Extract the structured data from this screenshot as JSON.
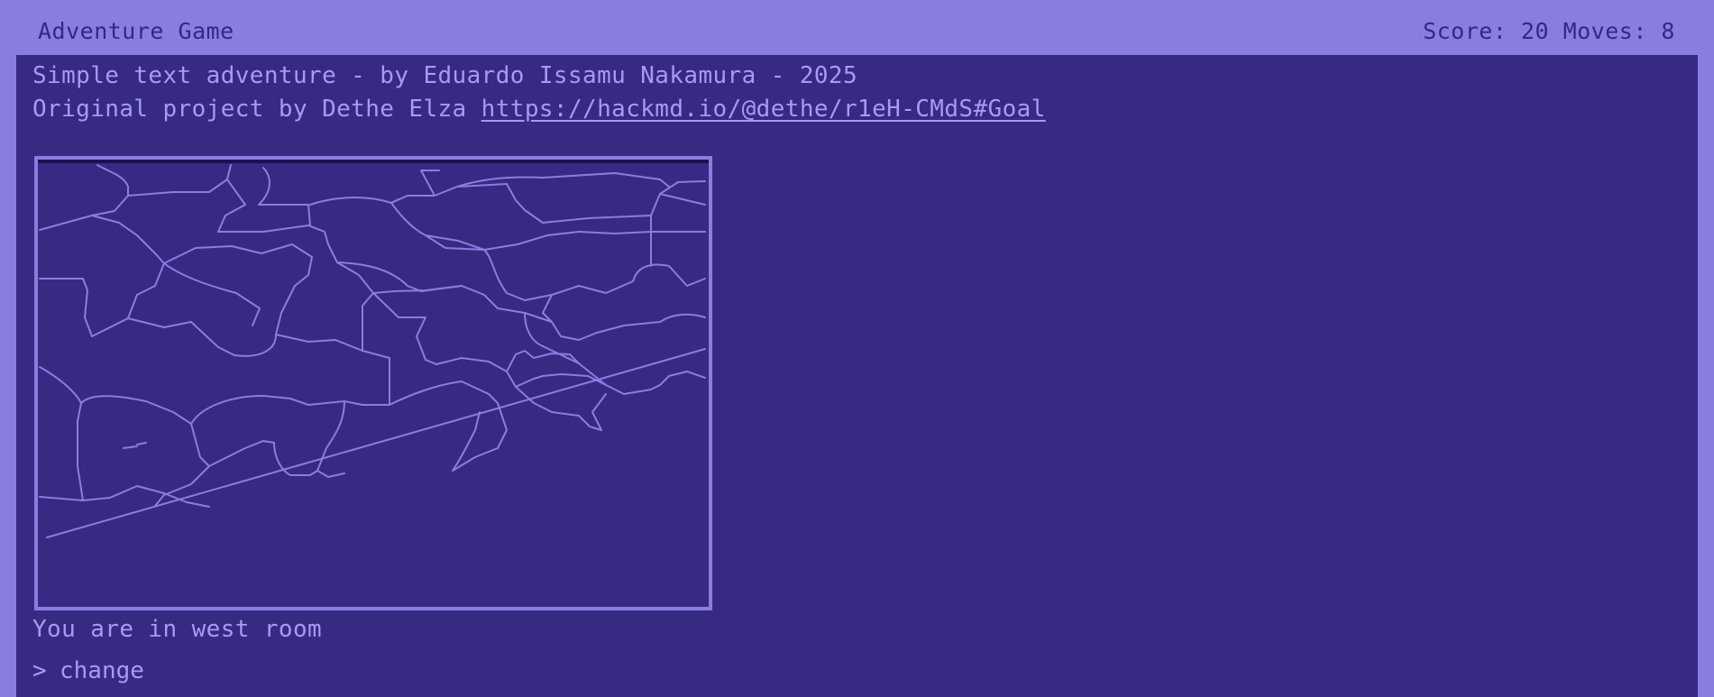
{
  "window": {
    "title": "Adventure Game",
    "status": "Score: 20 Moves: 8"
  },
  "intro": {
    "line1": "Simple text adventure - by Eduardo Issamu Nakamura - 2025",
    "line2_prefix": "Original project by Dethe Elza ",
    "link_text": "https://hackmd.io/@dethe/r1eH-CMdS#Goal"
  },
  "scene": {
    "description": "You are in west room"
  },
  "command": {
    "prompt": ">",
    "value": "change"
  },
  "colors": {
    "outer": "#8a7de0",
    "screen": "#372a83",
    "text": "#a59bf0",
    "line_art": "#8a7de0"
  },
  "icons": {
    "picture": "cracked-floor-line-art"
  }
}
